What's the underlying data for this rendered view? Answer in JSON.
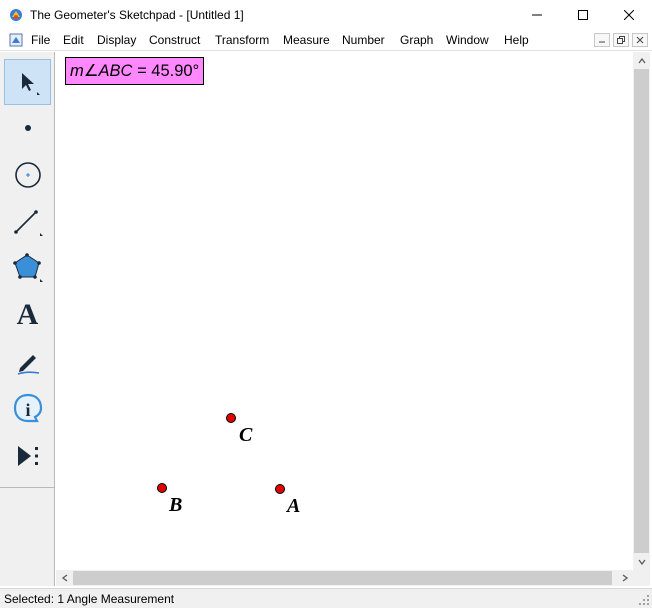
{
  "window": {
    "title": "The Geometer's Sketchpad - [Untitled 1]"
  },
  "menu": {
    "items": [
      "File",
      "Edit",
      "Display",
      "Construct",
      "Transform",
      "Measure",
      "Number",
      "Graph",
      "Window",
      "Help"
    ]
  },
  "toolbox": {
    "tools": [
      {
        "name": "arrow-selection-tool",
        "icon": "arrow-icon",
        "selected": true
      },
      {
        "name": "point-tool",
        "icon": "point-icon"
      },
      {
        "name": "compass-tool",
        "icon": "compass-circle-icon"
      },
      {
        "name": "straightedge-tool",
        "icon": "segment-icon"
      },
      {
        "name": "polygon-tool",
        "icon": "pentagon-icon"
      },
      {
        "name": "text-tool",
        "icon": "text-A-icon"
      },
      {
        "name": "marker-tool",
        "icon": "marker-pen-icon"
      },
      {
        "name": "information-tool",
        "icon": "info-icon"
      },
      {
        "name": "custom-tools",
        "icon": "custom-tool-icon"
      }
    ],
    "text_tool_glyph": "A",
    "info_tool_glyph": "i"
  },
  "canvas": {
    "measurement": {
      "prefix": "m",
      "angle_symbol": "∠",
      "angle_name": "ABC",
      "equals": " = ",
      "value": "45.90°",
      "background": "#ff88ff"
    },
    "points": [
      {
        "label": "C",
        "color": "#e00000"
      },
      {
        "label": "B",
        "color": "#e00000"
      },
      {
        "label": "A",
        "color": "#e00000"
      }
    ]
  },
  "status": {
    "text": "Selected: 1 Angle Measurement"
  }
}
